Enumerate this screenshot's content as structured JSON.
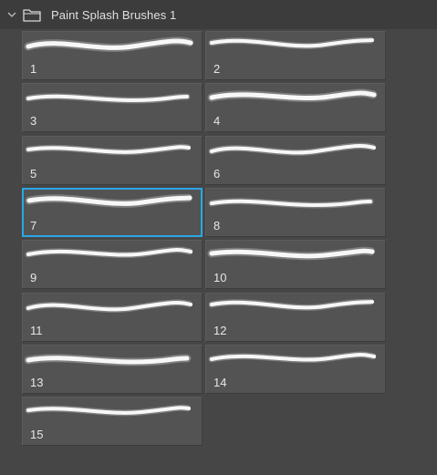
{
  "group": {
    "title": "Paint Splash Brushes 1",
    "expanded": true,
    "icons": {
      "toggle": "chevron-down-icon",
      "folder": "folder-icon"
    }
  },
  "selection_color": "#2aa7e6",
  "brushes": [
    {
      "label": "1",
      "selected": false
    },
    {
      "label": "2",
      "selected": false
    },
    {
      "label": "3",
      "selected": false
    },
    {
      "label": "4",
      "selected": false
    },
    {
      "label": "5",
      "selected": false
    },
    {
      "label": "6",
      "selected": false
    },
    {
      "label": "7",
      "selected": true
    },
    {
      "label": "8",
      "selected": false
    },
    {
      "label": "9",
      "selected": false
    },
    {
      "label": "10",
      "selected": false
    },
    {
      "label": "11",
      "selected": false
    },
    {
      "label": "12",
      "selected": false
    },
    {
      "label": "13",
      "selected": false
    },
    {
      "label": "14",
      "selected": false
    },
    {
      "label": "15",
      "selected": false
    }
  ]
}
